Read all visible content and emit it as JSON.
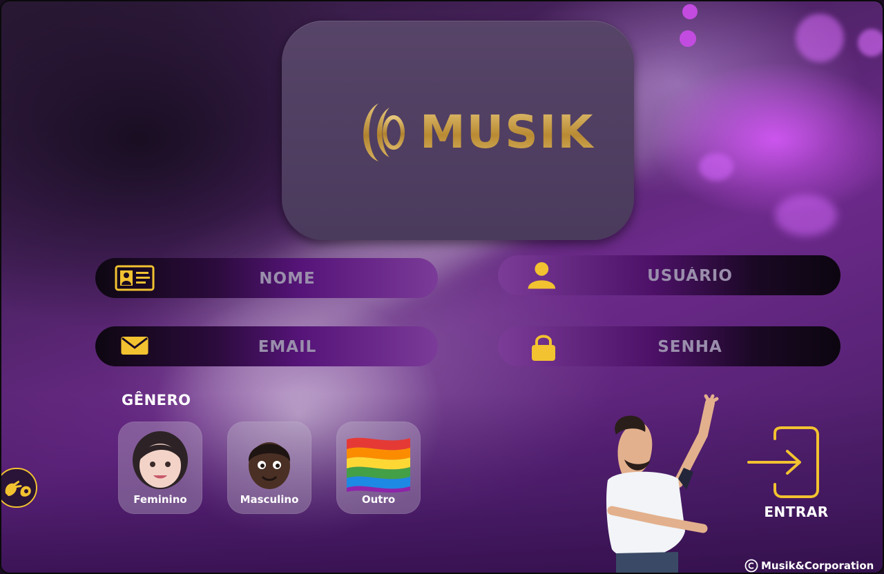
{
  "brand": {
    "logo_text": "MUSIK",
    "gold": "#c9a24a"
  },
  "form": {
    "nome": {
      "placeholder": "NOME",
      "icon": "id-card-icon"
    },
    "usuario": {
      "placeholder": "USUÁRIO",
      "icon": "user-icon"
    },
    "email": {
      "placeholder": "EMAIL",
      "icon": "envelope-icon"
    },
    "senha": {
      "placeholder": "SENHA",
      "icon": "lock-icon"
    }
  },
  "genero": {
    "label": "GÊNERO",
    "options": [
      {
        "label": "Feminino",
        "icon": "woman-avatar-icon"
      },
      {
        "label": "Masculino",
        "icon": "man-avatar-icon"
      },
      {
        "label": "Outro",
        "icon": "rainbow-flag-icon"
      }
    ]
  },
  "enter": {
    "label": "ENTRAR",
    "icon": "login-arrow-icon"
  },
  "accessibility": {
    "icon": "sign-language-icon"
  },
  "footer": {
    "copyright": "Musik&Corporation"
  },
  "colors": {
    "accent_yellow": "#f2c230",
    "purple": "#6c2a8a",
    "card": "#4f3e61"
  }
}
